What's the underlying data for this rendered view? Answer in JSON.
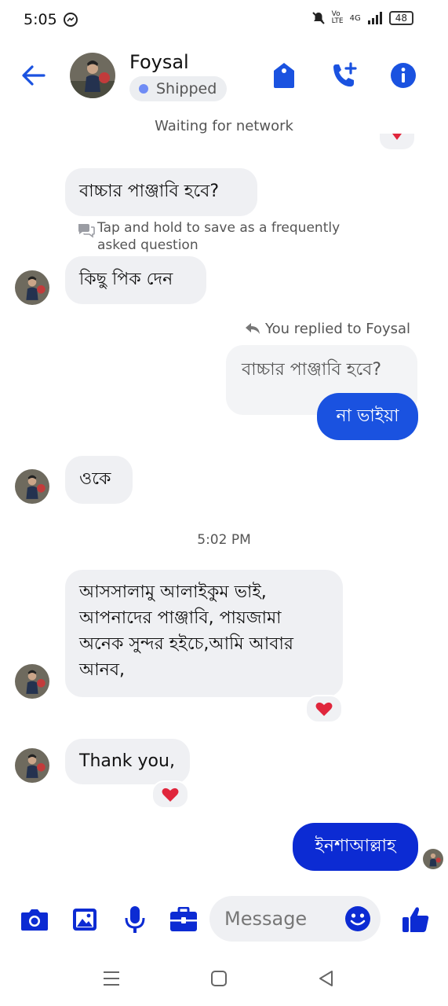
{
  "status_bar": {
    "time": "5:05",
    "battery": "48",
    "network": "4G"
  },
  "header": {
    "contact_name": "Foysal",
    "label_chip": "Shipped",
    "connection_status": "Waiting for network"
  },
  "messages": {
    "question_1": "বাচ্চার পাঞ্জাবি হবে?",
    "faq_hint_line1": "Tap and hold to save as a frequently",
    "faq_hint_line2": "asked question",
    "incoming_1": "কিছু পিক দেন",
    "reply_context": "You replied to Foysal",
    "quoted_text": "বাচ্চার পাঞ্জাবি হবে?",
    "outgoing_1": "না ভাইয়া",
    "incoming_2": "ওকে",
    "timestamp": "5:02 PM",
    "incoming_3_lines": [
      "আসসালামু আলাইকুম ভাই,",
      "আপনাদের পাঞ্জাবি, পায়জামা",
      "অনেক সুন্দর হইচে,আমি আবার",
      "আনব,"
    ],
    "incoming_4": "Thank you,",
    "outgoing_2": "ইনশাআল্লাহ"
  },
  "composer": {
    "placeholder": "Message"
  },
  "colors": {
    "accent": "#1a52e0",
    "bubble_in": "#eff0f3",
    "reaction_heart": "#e0263c"
  },
  "icons": [
    "back-arrow-icon",
    "tag-icon",
    "add-call-icon",
    "info-icon",
    "camera-icon",
    "gallery-icon",
    "mic-icon",
    "briefcase-icon",
    "emoji-icon",
    "thumbs-up-icon",
    "heart-icon",
    "reply-icon",
    "chat-bubbles-icon"
  ]
}
